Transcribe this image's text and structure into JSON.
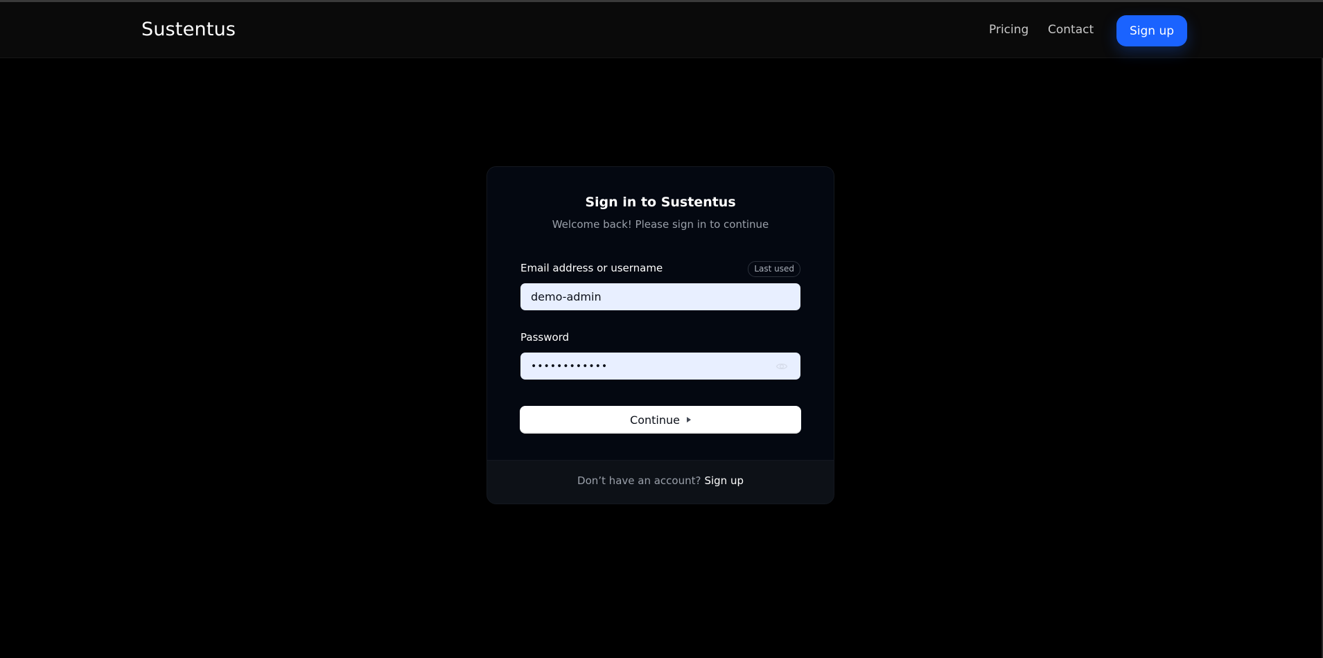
{
  "header": {
    "brand": "Sustentus",
    "nav": {
      "pricing": "Pricing",
      "contact": "Contact",
      "signup": "Sign up"
    }
  },
  "signin": {
    "title": "Sign in to Sustentus",
    "subtitle": "Welcome back! Please sign in to continue",
    "email_label": "Email address or username",
    "last_used_badge": "Last used",
    "email_value": "demo-admin",
    "password_label": "Password",
    "password_value": "••••••••••••",
    "password_toggle_icon": "eye-icon",
    "continue_label": "Continue",
    "continue_icon": "caret-right-icon",
    "footer_prompt": "Don’t have an account?",
    "footer_link": "Sign up"
  },
  "colors": {
    "background": "#000000",
    "navbar": "#0a0a0a",
    "accent": "#1a63ff",
    "card": "#040811",
    "card_footer": "#0d1117",
    "input_bg": "#e8efff"
  }
}
